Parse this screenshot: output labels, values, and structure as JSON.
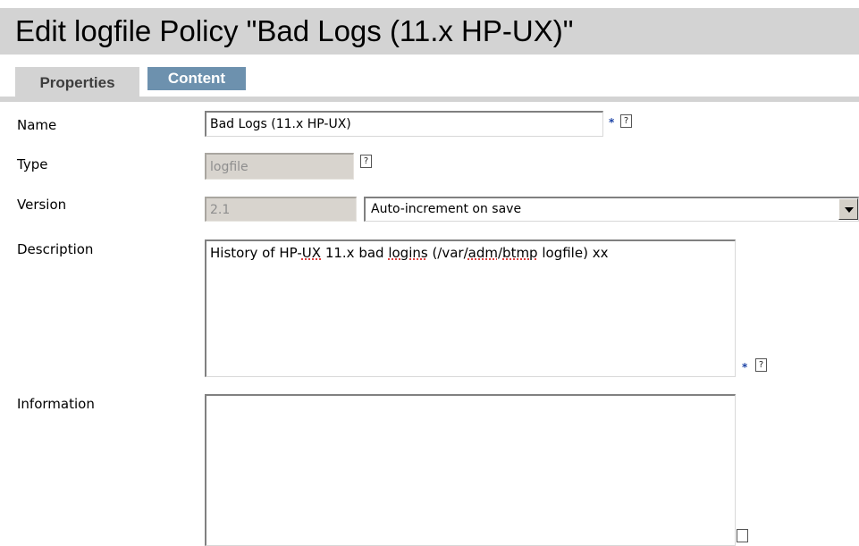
{
  "page": {
    "title": "Edit logfile Policy \"Bad Logs (11.x HP-UX)\""
  },
  "tabs": [
    {
      "label": "Properties",
      "active": true
    },
    {
      "label": "Content",
      "active": false
    }
  ],
  "form": {
    "name": {
      "label": "Name",
      "value": "Bad Logs (11.x HP-UX)",
      "required_mark": "*",
      "help": "?"
    },
    "type": {
      "label": "Type",
      "value": "logfile",
      "help": "?"
    },
    "version": {
      "label": "Version",
      "value": "2.1",
      "increment_option": "Auto-increment on save"
    },
    "description": {
      "label": "Description",
      "value_parts": [
        "History of HP-",
        "UX",
        " 11.x bad ",
        "logins",
        " (/var/",
        "adm",
        "/",
        "btmp",
        " logfile) xx"
      ],
      "required_mark": "*",
      "help": "?"
    },
    "information": {
      "label": "Information",
      "value": ""
    }
  },
  "colors": {
    "title_band": "#d3d3d3",
    "active_tab": "#d3d3d3",
    "inactive_tab": "#6d91ae",
    "required_mark": "#1d44a6"
  },
  "icons": {
    "help": "question-mark-box-icon",
    "dropdown": "chevron-down-icon"
  }
}
